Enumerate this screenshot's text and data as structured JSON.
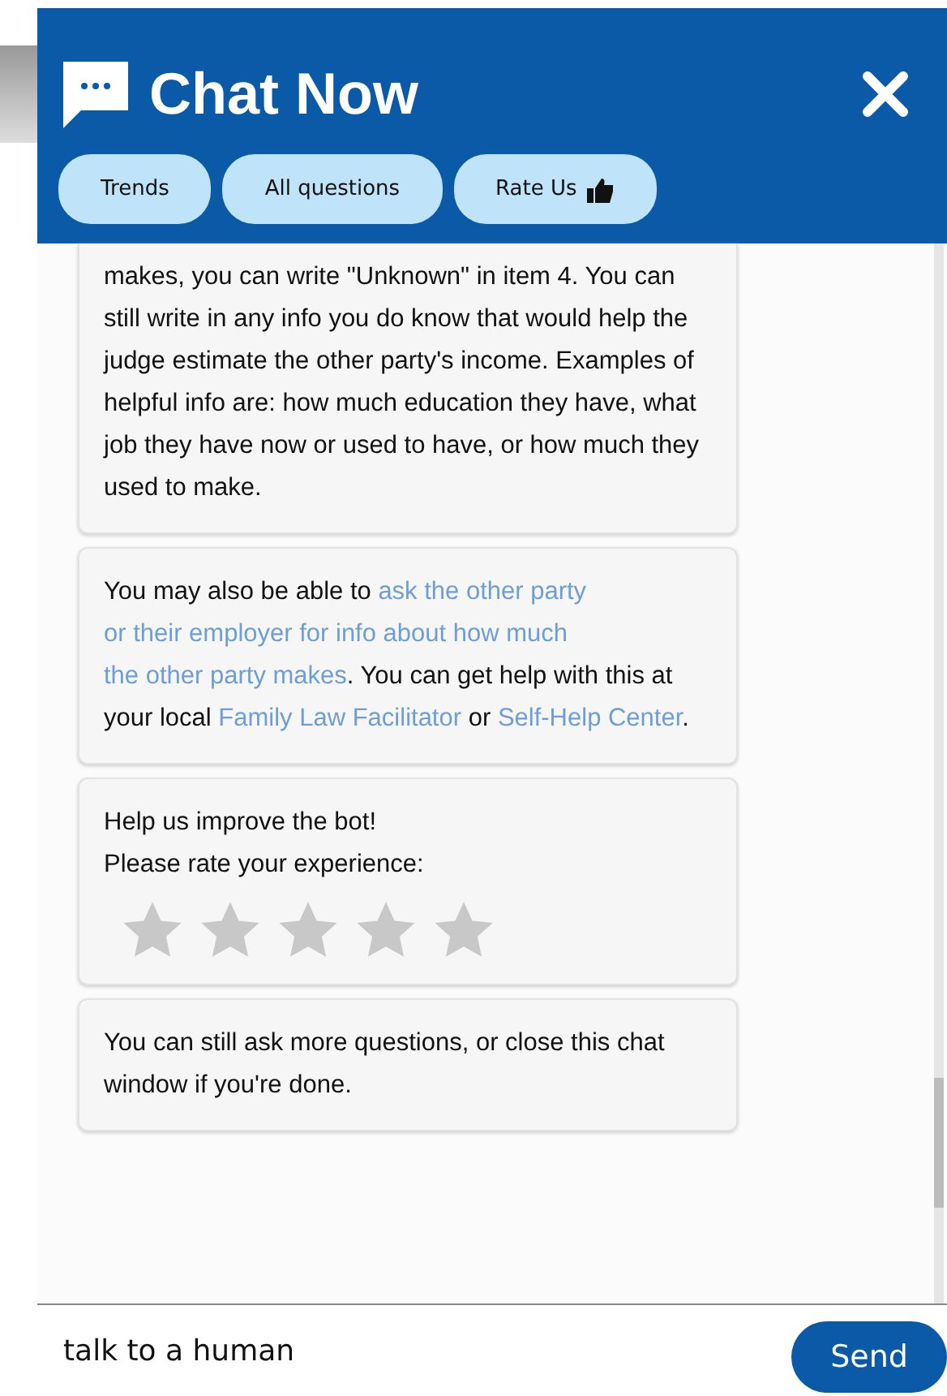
{
  "header": {
    "title": "Chat Now",
    "buttons": [
      {
        "label": "Trends",
        "icon": false
      },
      {
        "label": "All questions",
        "icon": false
      },
      {
        "label": "Rate Us",
        "icon": true
      }
    ]
  },
  "messages": [
    {
      "kind": "text",
      "parts": [
        {
          "kind": "text",
          "text": "makes, you can write \"Unknown\" in item 4. You can still write in any info you do know that would help the judge estimate the other party's income. Examples of helpful info are: how much education they have, what job they have now or used to have, or how much they used to make."
        }
      ]
    },
    {
      "kind": "text",
      "parts": [
        {
          "kind": "text",
          "text": "You may also be able to "
        },
        {
          "kind": "link",
          "text": "ask the other party"
        },
        {
          "kind": "link",
          "text": "or their employer for info about how much"
        },
        {
          "kind": "link",
          "text": "the other party makes"
        },
        {
          "kind": "text",
          "text": ". You can get help with this at your local "
        },
        {
          "kind": "link",
          "text": "Family Law Facilitator"
        },
        {
          "kind": "text",
          "text": " or "
        },
        {
          "kind": "link",
          "text": "Self-Help Center"
        },
        {
          "kind": "text",
          "text": "."
        }
      ]
    },
    {
      "kind": "rating",
      "lines": [
        "Help us improve the bot!",
        "Please rate your experience:"
      ],
      "stars": 0
    },
    {
      "kind": "text",
      "parts": [
        {
          "kind": "text",
          "text": "You can still ask more questions, or close this chat window if you're done."
        }
      ]
    }
  ],
  "input": {
    "value": "talk to a human"
  },
  "send": "Send"
}
